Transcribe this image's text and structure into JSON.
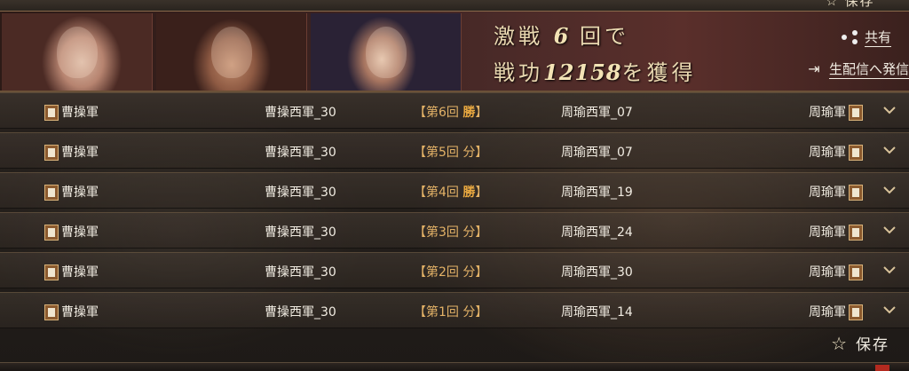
{
  "top": {
    "save_label": "保存"
  },
  "banner": {
    "line1_prefix": "激戦",
    "battles": "6",
    "line1_suffix": "回で",
    "line2_prefix": "戦功",
    "merit": "12158",
    "line2_suffix": "を獲得",
    "share_label": "共有",
    "stream_label": "生配信へ発信"
  },
  "rows": [
    {
      "army_left": "曹操軍",
      "player_left": "曹操西軍_30",
      "round": "【第6回",
      "result": "勝",
      "close": "】",
      "player_right": "周瑜西軍_07",
      "army_right": "周瑜軍"
    },
    {
      "army_left": "曹操軍",
      "player_left": "曹操西軍_30",
      "round": "【第5回",
      "result": "分",
      "close": "】",
      "player_right": "周瑜西軍_07",
      "army_right": "周瑜軍"
    },
    {
      "army_left": "曹操軍",
      "player_left": "曹操西軍_30",
      "round": "【第4回",
      "result": "勝",
      "close": "】",
      "player_right": "周瑜西軍_19",
      "army_right": "周瑜軍"
    },
    {
      "army_left": "曹操軍",
      "player_left": "曹操西軍_30",
      "round": "【第3回",
      "result": "分",
      "close": "】",
      "player_right": "周瑜西軍_24",
      "army_right": "周瑜軍"
    },
    {
      "army_left": "曹操軍",
      "player_left": "曹操西軍_30",
      "round": "【第2回",
      "result": "分",
      "close": "】",
      "player_right": "周瑜西軍_30",
      "army_right": "周瑜軍"
    },
    {
      "army_left": "曹操軍",
      "player_left": "曹操西軍_30",
      "round": "【第1回",
      "result": "分",
      "close": "】",
      "player_right": "周瑜西軍_14",
      "army_right": "周瑜軍"
    }
  ],
  "footer": {
    "save_label": "保存"
  },
  "icons": {
    "share": "share-icon",
    "stream": "stream-icon",
    "star": "star-icon",
    "chevron": "chevron-down-icon",
    "flag": "army-flag-icon"
  }
}
